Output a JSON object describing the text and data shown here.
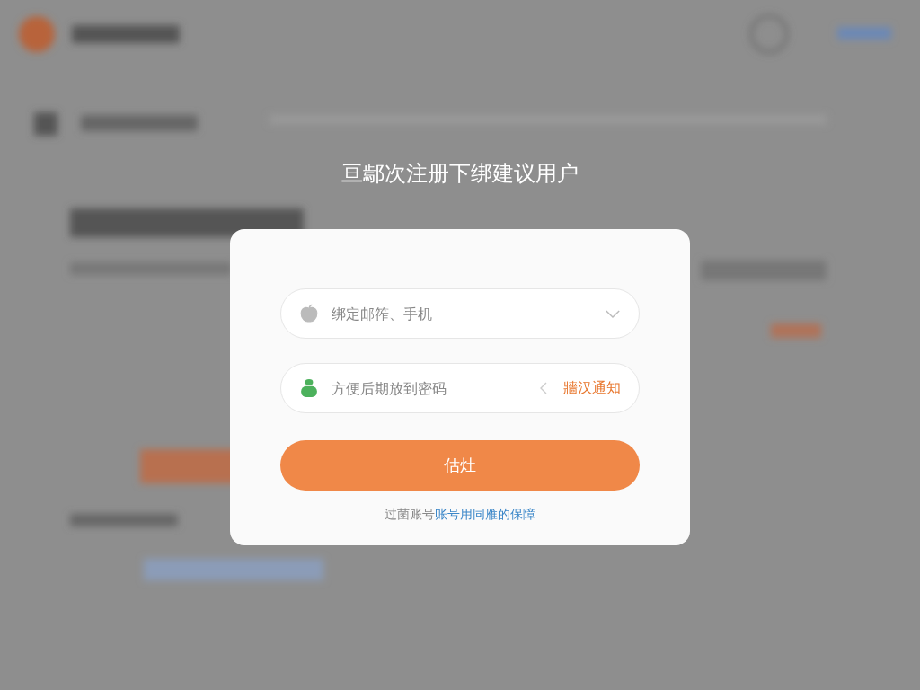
{
  "title": "亘鄢次注册下绑建议用户",
  "fields": [
    {
      "kind": "select",
      "placeholder": "绑定邮筰、手机"
    },
    {
      "kind": "code",
      "placeholder": "方便后期放到密码",
      "action": "牆汉通知"
    }
  ],
  "submit": "估灶",
  "footer": {
    "text": "过菌账号",
    "link": "账号用同雁的保障"
  }
}
